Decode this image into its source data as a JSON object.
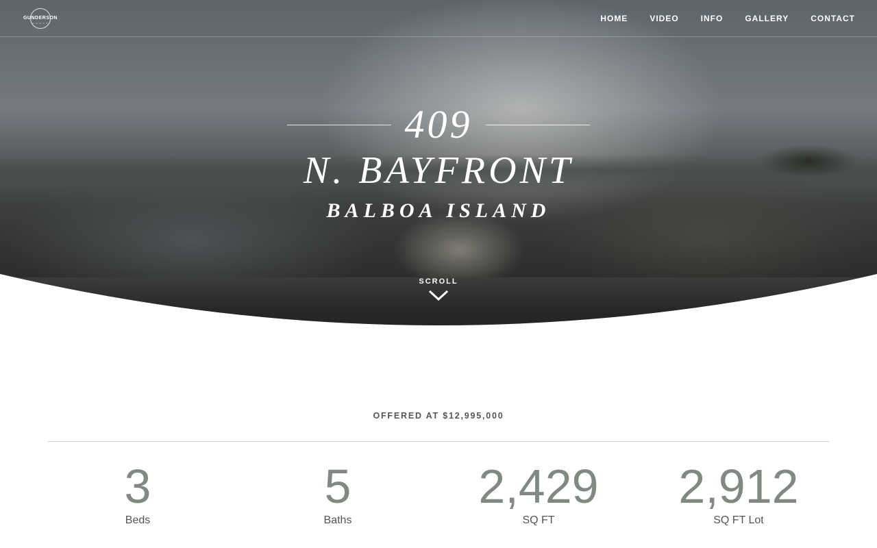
{
  "logo": {
    "word": "GUNDERSON",
    "sub": "G R O U P"
  },
  "nav": {
    "items": [
      "HOME",
      "VIDEO",
      "INFO",
      "GALLERY",
      "CONTACT"
    ]
  },
  "hero": {
    "number": "409",
    "street": "N. BAYFRONT",
    "area": "BALBOA ISLAND",
    "scroll_label": "SCROLL"
  },
  "listing": {
    "price_label": "OFFERED AT $12,995,000",
    "stats": [
      {
        "value": "3",
        "label": "Beds"
      },
      {
        "value": "5",
        "label": "Baths"
      },
      {
        "value": "2,429",
        "label": "SQ FT"
      },
      {
        "value": "2,912",
        "label": "SQ FT Lot"
      }
    ]
  },
  "colors": {
    "stat_value": "#808a82",
    "curve_fill": "#ffffff"
  },
  "icons": {
    "scroll": "chevron-down-icon",
    "logo": "circle-logo-icon"
  }
}
